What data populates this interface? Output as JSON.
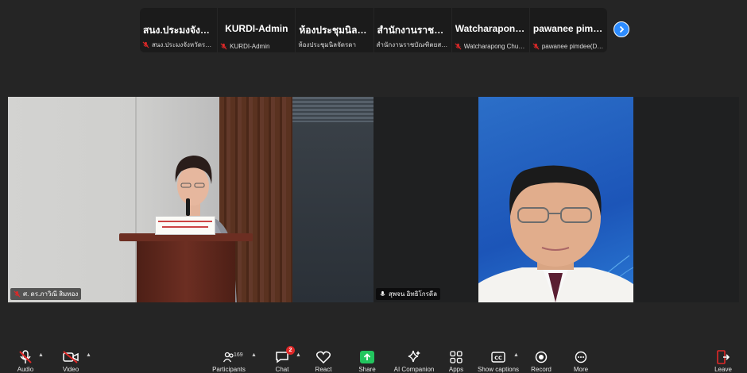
{
  "strip": {
    "participants": [
      {
        "name": "สนง.ประมงจังหวั...",
        "label": "สนง.ประมงจังหวัดราชบุรี"
      },
      {
        "name": "KURDI-Admin",
        "label": "KURDI-Admin"
      },
      {
        "name": "ห้องประชุมนิลจัด...",
        "label": "ห้องประชุมนิลจัดรดา"
      },
      {
        "name": "สำนักงานราชบัณ...",
        "label": "สำนักงานราชบัณฑิตยสภา"
      },
      {
        "name": "Watcharapong...",
        "label": "Watcharapong Chumc..."
      },
      {
        "name": "pawanee pimde...",
        "label": "pawanee pimdee(DOF)"
      }
    ]
  },
  "videos": {
    "left_name": "ศ. ดร.ภาวิณี สิมทอง",
    "right_name": "สุพจน อิทธิโกรดีล"
  },
  "toolbar": {
    "audio": "Audio",
    "video": "Video",
    "participants": "Participants",
    "participants_count": "169",
    "chat": "Chat",
    "chat_badge": "2",
    "react": "React",
    "share": "Share",
    "ai_companion": "AI Companion",
    "apps": "Apps",
    "captions": "Show captions",
    "record": "Record",
    "more": "More",
    "leave": "Leave"
  },
  "colors": {
    "accent": "#2d8cff",
    "danger": "#e02828",
    "share": "#22c55e",
    "background": "#252525"
  },
  "icons": [
    "microphone-muted-icon",
    "camera-off-icon",
    "participants-icon",
    "chat-icon",
    "heart-icon",
    "share-arrow-icon",
    "sparkle-icon",
    "apps-icon",
    "cc-icon",
    "record-icon",
    "more-icon",
    "leave-icon",
    "chevron-right-icon"
  ]
}
